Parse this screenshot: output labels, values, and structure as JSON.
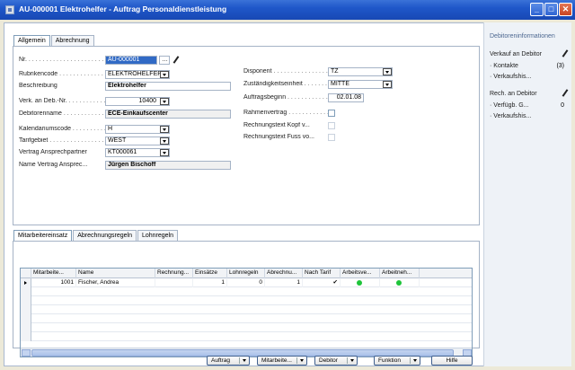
{
  "window": {
    "title": "AU-000001 Elektrohelfer - Auftrag Personaldienstleistung"
  },
  "tabs_top": [
    {
      "label": "Allgemein",
      "active": true
    },
    {
      "label": "Abrechnung",
      "active": false
    }
  ],
  "general": {
    "nr": {
      "label": "Nr.",
      "value": "AU-000001"
    },
    "rubrikencode": {
      "label": "Rubrikencode",
      "value": "ELEKTROHELFER"
    },
    "beschreibung": {
      "label": "Beschreibung",
      "value": "Elektrohelfer"
    },
    "verk_an_deb": {
      "label": "Verk. an Deb.-Nr.",
      "value": "10400"
    },
    "debitorenname": {
      "label": "Debitorenname",
      "value": "ECE-Einkaufscenter"
    },
    "kalendariumscode": {
      "label": "Kalendariumscode",
      "value": "H"
    },
    "tarifgebiet": {
      "label": "Tarifgebiet",
      "value": "WEST"
    },
    "vertrag_ansprechpartner": {
      "label": "Vertrag Ansprechpartner",
      "value": "KT000061"
    },
    "name_vertrag_ansprec": {
      "label": "Name Vertrag Ansprec...",
      "value": "Jürgen Bischoff"
    },
    "disponent": {
      "label": "Disponent",
      "value": "TZ"
    },
    "zustaendigkeitseinheit": {
      "label": "Zuständigkeitseinheit",
      "value": "MITTE"
    },
    "auftragsbeginn": {
      "label": "Auftragsbeginn",
      "value": "02.01.08"
    },
    "rahmenvertrag": {
      "label": "Rahmenvertrag"
    },
    "rechnungstext_kopf": {
      "label": "Rechnungstext Kopf v..."
    },
    "rechnungstext_fuss": {
      "label": "Rechnungstext Fuss vo..."
    }
  },
  "tabs_lower": [
    {
      "label": "Mitarbeitereinsatz",
      "active": true
    },
    {
      "label": "Abrechnungsregeln",
      "active": false
    },
    {
      "label": "Lohnregeln",
      "active": false
    }
  ],
  "grid": {
    "columns": [
      "Mitarbeite...",
      "Name",
      "Rechnung...",
      "Einsätze",
      "Lohnregeln",
      "Abrechnu...",
      "Nach Tarif",
      "Arbeitsve...",
      "Arbeitneh..."
    ],
    "rows": [
      {
        "mitarbeiter": "1001",
        "name": "Fischer, Andrea",
        "rechnung": "",
        "einsaetze": "1",
        "lohnregeln": "0",
        "abrechnung": "1",
        "nach_tarif": "✔",
        "status1": "green",
        "status2": "green"
      }
    ]
  },
  "side": {
    "header": "Debitoreninformationen",
    "verkauf": "Verkauf an Debitor",
    "kontakte": "Kontakte",
    "kontakte_count": "(3)",
    "verkaufshis1": "Verkaufshis...",
    "rech": "Rech. an Debitor",
    "verfuegb": "Verfügb. G...",
    "verfuegb_val": "0",
    "verkaufshis2": "Verkaufshis..."
  },
  "buttons": {
    "auftrag": "Auftrag",
    "mitarbeiter": "Mitarbeite...",
    "debitor": "Debitor",
    "funktion": "Funktion",
    "hilfe": "Hilfe"
  },
  "colors": {
    "titlebar": "#1f57c9",
    "selection": "#316ac5",
    "status_green": "#1ec43a"
  }
}
